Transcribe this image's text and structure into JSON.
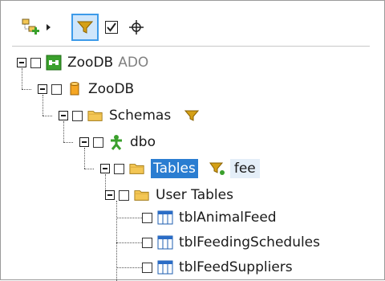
{
  "toolbar": {
    "buttons": [
      {
        "icon": "add-object-icon"
      },
      {
        "icon": "dropdown-arrow-icon"
      },
      {
        "icon": "filter-icon"
      },
      {
        "icon": "checkbox-checked-icon"
      },
      {
        "icon": "crosshair-icon"
      }
    ]
  },
  "tree": {
    "root": {
      "label": "ZooDB",
      "suffix": "ADO"
    },
    "database": {
      "label": "ZooDB"
    },
    "schemas": {
      "label": "Schemas"
    },
    "dbo": {
      "label": "dbo"
    },
    "tables": {
      "label": "Tables",
      "filter_text": "fee"
    },
    "user_tables": {
      "label": "User Tables"
    },
    "items": [
      {
        "label": "tblAnimalFeed"
      },
      {
        "label": "tblFeedingSchedules"
      },
      {
        "label": "tblFeedSuppliers"
      }
    ]
  },
  "colors": {
    "selection": "#2a7dd1",
    "filter": "#d4a017",
    "folder": "#f3c654",
    "dbo": "#3aa02c"
  }
}
